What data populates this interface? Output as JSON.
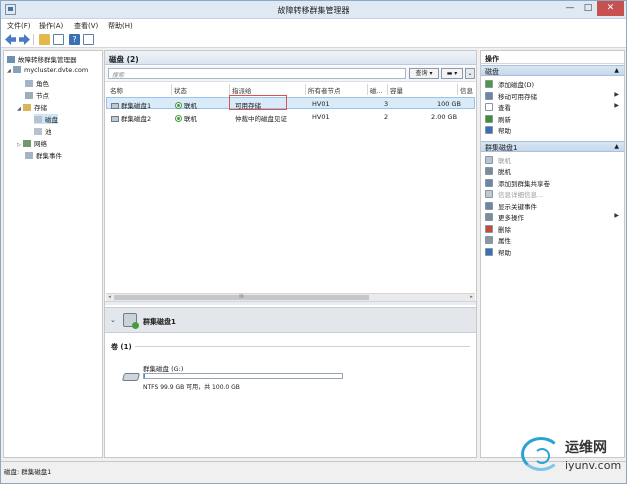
{
  "window": {
    "title": "故障转移群集管理器",
    "min": "—",
    "max": "□",
    "close": "✕"
  },
  "menu": [
    "文件(F)",
    "操作(A)",
    "查看(V)",
    "帮助(H)"
  ],
  "toolbar": {
    "help_glyph": "?"
  },
  "tree": {
    "root": "故障转移群集管理器",
    "cluster": "mycluster.dvte.com",
    "roles": "角色",
    "nodes": "节点",
    "storage": "存储",
    "disks": "磁盘",
    "pools": "池",
    "networks": "网络",
    "cluster_events": "群集事件"
  },
  "center": {
    "header": "磁盘 (2)",
    "search_placeholder": "搜索",
    "query_label": "查询",
    "save_glyph": "▾",
    "expand_glyph": "⌄",
    "columns": [
      "名称",
      "状态",
      "指派给",
      "所有者节点",
      "磁...",
      "容量",
      "信息"
    ],
    "rows": [
      {
        "name": "群集磁盘1",
        "status": "联机",
        "assigned": "可用存储",
        "owner": "HV01",
        "disk": "3",
        "capacity": "100 GB"
      },
      {
        "name": "群集磁盘2",
        "status": "联机",
        "assigned": "仲裁中的磁盘见证",
        "owner": "HV01",
        "disk": "2",
        "capacity": "2.00 GB"
      }
    ],
    "scroll_glyph": "III",
    "detail_title": "群集磁盘1",
    "volumes_label": "卷 (1)",
    "volume_name": "群集磁盘 (G:)",
    "volume_info": "NTFS 99.9 GB 可用，共 100.0 GB",
    "volume_used_fraction": 0.001
  },
  "actions": {
    "title": "操作",
    "sections": [
      {
        "label": "磁盘",
        "items": [
          {
            "label": "添加磁盘(D)",
            "icon": "add-disk-icon",
            "color": "#4a9a3f",
            "submenu": false,
            "disabled": false
          },
          {
            "label": "移动可用存储",
            "icon": "move-icon",
            "color": "#6b86a8",
            "submenu": true,
            "disabled": false
          },
          {
            "label": "查看",
            "icon": "view-icon",
            "color": "#ffffff",
            "submenu": true,
            "disabled": false
          },
          {
            "label": "刷新",
            "icon": "refresh-icon",
            "color": "#3f8f3a",
            "submenu": false,
            "disabled": false
          },
          {
            "label": "帮助",
            "icon": "help-icon",
            "color": "#3b6fb6",
            "submenu": false,
            "disabled": false
          }
        ]
      },
      {
        "label": "群集磁盘1",
        "items": [
          {
            "label": "联机",
            "icon": "online-icon",
            "color": "#b8c4cf",
            "submenu": false,
            "disabled": true
          },
          {
            "label": "脱机",
            "icon": "offline-icon",
            "color": "#7c8b99",
            "submenu": false,
            "disabled": false
          },
          {
            "label": "添加到群集共享卷",
            "icon": "csv-icon",
            "color": "#6b86a8",
            "submenu": false,
            "disabled": false
          },
          {
            "label": "信息详细信息...",
            "icon": "info-icon",
            "color": "#c0c8d0",
            "submenu": false,
            "disabled": true
          },
          {
            "label": "显示关键事件",
            "icon": "events-icon",
            "color": "#6b86a8",
            "submenu": false,
            "disabled": false
          },
          {
            "label": "更多操作",
            "icon": "more-actions-icon",
            "color": "#7c8b99",
            "submenu": true,
            "disabled": false
          },
          {
            "label": "删除",
            "icon": "delete-icon",
            "color": "#c44b3d",
            "submenu": false,
            "disabled": false
          },
          {
            "label": "属性",
            "icon": "properties-icon",
            "color": "#8c96a0",
            "submenu": false,
            "disabled": false
          },
          {
            "label": "帮助",
            "icon": "help-icon",
            "color": "#3b6fb6",
            "submenu": false,
            "disabled": false
          }
        ]
      }
    ],
    "submenu_glyph": "▶",
    "collapse_glyph": "▲"
  },
  "status": "磁盘: 群集磁盘1",
  "watermark": {
    "cn": "运维网",
    "en": "iyunv.com"
  }
}
